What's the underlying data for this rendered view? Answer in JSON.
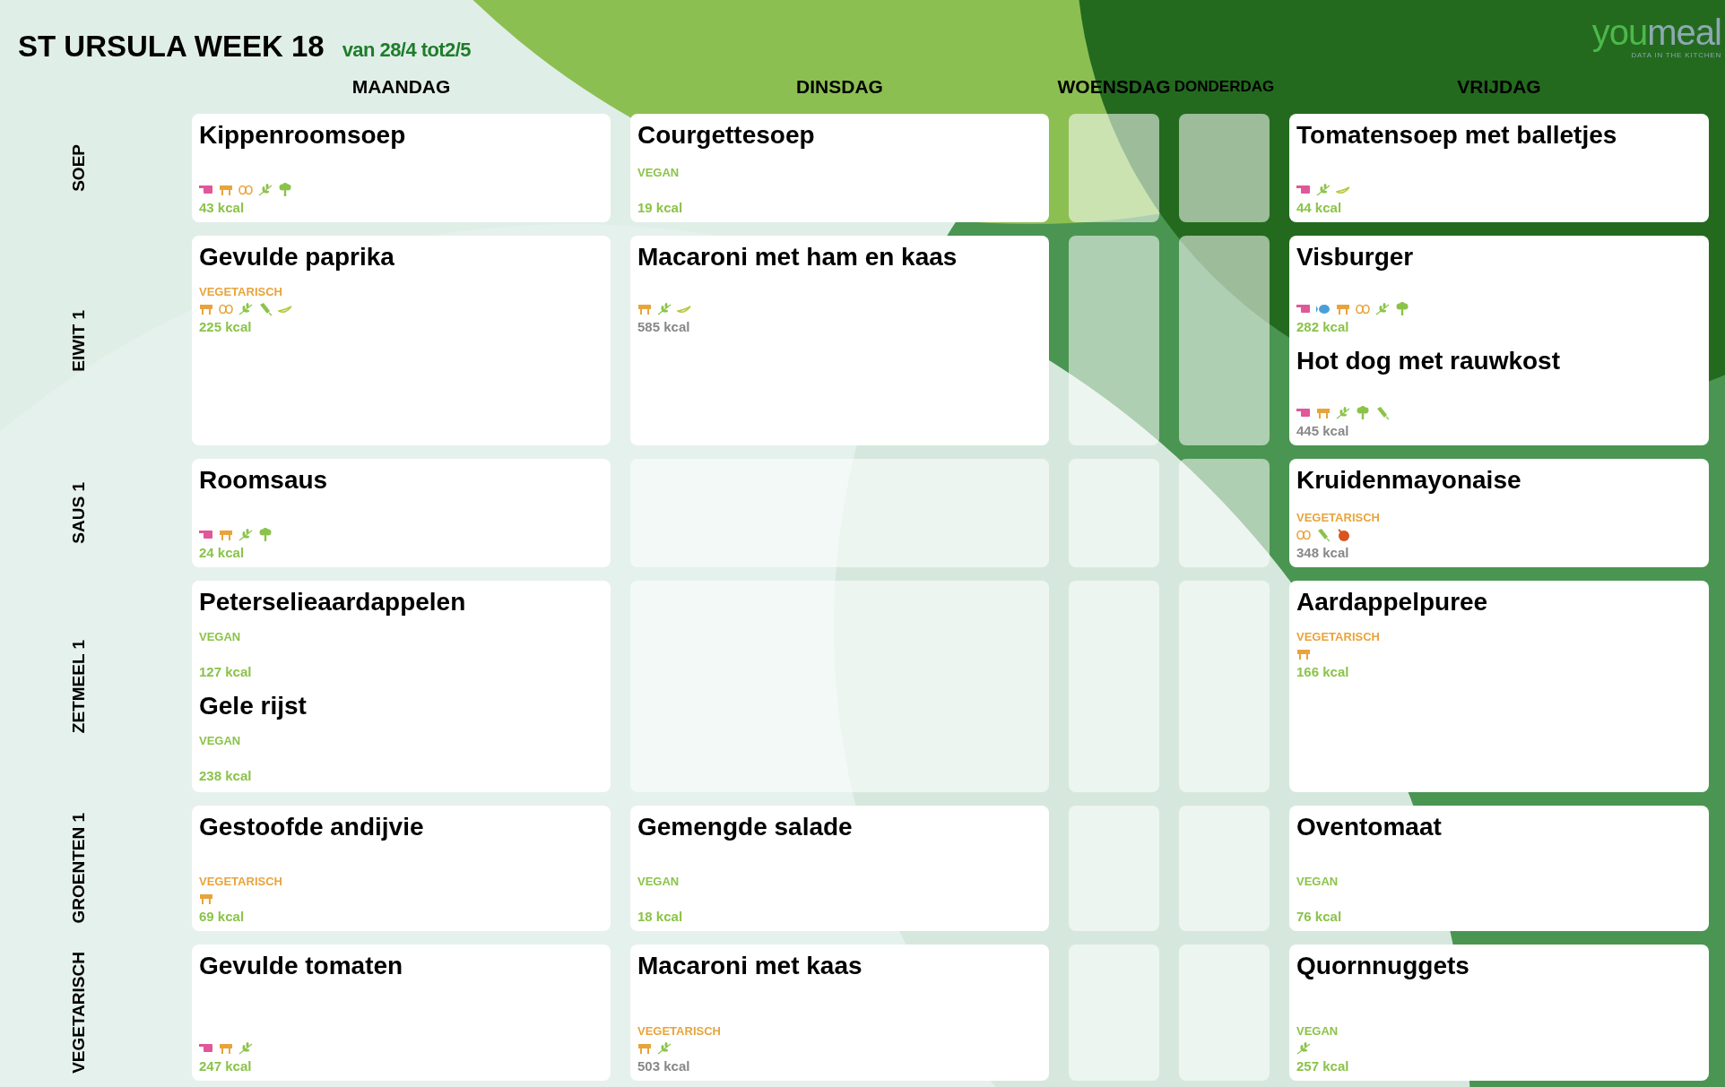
{
  "header": {
    "title": "ST URSULA WEEK 18",
    "date_range": "van 28/4 tot2/5"
  },
  "logo": {
    "wordmark": [
      "you",
      "meal"
    ],
    "tagline": "DATA IN THE KITCHEN"
  },
  "days": [
    "MAANDAG",
    "DINSDAG",
    "WOENSDAG",
    "DONDERDAG",
    "VRIJDAG"
  ],
  "rows": [
    {
      "label": "SOEP",
      "cells": [
        {
          "kind": "filled",
          "dishes": [
            {
              "name": "Kippenroomsoep",
              "allergens": [
                {
                  "kind": "meat"
                },
                {
                  "kind": "dairy"
                },
                {
                  "kind": "egg"
                },
                {
                  "kind": "gluten"
                },
                {
                  "kind": "celery"
                }
              ],
              "kcal": {
                "text": "43 kcal",
                "color": "#8bc34a"
              }
            }
          ]
        },
        {
          "kind": "filled",
          "dishes": [
            {
              "name": "Courgettesoep",
              "tag": {
                "label": "VEGAN",
                "color": "#8bc34a"
              },
              "kcal": {
                "text": "19 kcal",
                "color": "#8bc34a"
              }
            }
          ]
        },
        {
          "kind": "empty"
        },
        {
          "kind": "empty"
        },
        {
          "kind": "filled",
          "dishes": [
            {
              "name": "Tomatensoep met balletjes",
              "allergens": [
                {
                  "kind": "meat"
                },
                {
                  "kind": "gluten"
                },
                {
                  "kind": "pod"
                }
              ],
              "kcal": {
                "text": "44 kcal",
                "color": "#8bc34a"
              }
            }
          ]
        }
      ]
    },
    {
      "label": "EIWIT 1",
      "cells": [
        {
          "kind": "filled",
          "dishes": [
            {
              "name": "Gevulde paprika",
              "tag": {
                "label": "VEGETARISCH",
                "color": "#e8a43c"
              },
              "allergens": [
                {
                  "kind": "dairy"
                },
                {
                  "kind": "egg"
                },
                {
                  "kind": "gluten"
                },
                {
                  "kind": "mustard"
                },
                {
                  "kind": "pod"
                }
              ],
              "kcal": {
                "text": "225 kcal",
                "color": "#8bc34a"
              }
            }
          ]
        },
        {
          "kind": "filled",
          "dishes": [
            {
              "name": "Macaroni met ham en kaas",
              "allergens": [
                {
                  "kind": "dairy"
                },
                {
                  "kind": "gluten"
                },
                {
                  "kind": "pod"
                }
              ],
              "kcal": {
                "text": "585 kcal",
                "color": "#888888"
              }
            }
          ]
        },
        {
          "kind": "empty"
        },
        {
          "kind": "empty"
        },
        {
          "kind": "filled",
          "dishes": [
            {
              "name": "Visburger",
              "allergens": [
                {
                  "kind": "meat"
                },
                {
                  "kind": "fish"
                },
                {
                  "kind": "dairy"
                },
                {
                  "kind": "egg"
                },
                {
                  "kind": "gluten"
                },
                {
                  "kind": "celery"
                }
              ],
              "kcal": {
                "text": "282 kcal",
                "color": "#8bc34a"
              }
            },
            {
              "name": "Hot dog met rauwkost",
              "allergens": [
                {
                  "kind": "meat"
                },
                {
                  "kind": "dairy"
                },
                {
                  "kind": "gluten"
                },
                {
                  "kind": "celery"
                },
                {
                  "kind": "mustard"
                }
              ],
              "kcal": {
                "text": "445 kcal",
                "color": "#888888"
              }
            }
          ]
        }
      ]
    },
    {
      "label": "SAUS 1",
      "cells": [
        {
          "kind": "filled",
          "dishes": [
            {
              "name": "Roomsaus",
              "allergens": [
                {
                  "kind": "meat"
                },
                {
                  "kind": "dairy"
                },
                {
                  "kind": "gluten"
                },
                {
                  "kind": "celery"
                }
              ],
              "kcal": {
                "text": "24 kcal",
                "color": "#8bc34a"
              }
            }
          ]
        },
        {
          "kind": "empty"
        },
        {
          "kind": "empty"
        },
        {
          "kind": "empty"
        },
        {
          "kind": "filled",
          "dishes": [
            {
              "name": "Kruidenmayonaise",
              "tag": {
                "label": "VEGETARISCH",
                "color": "#e8a43c"
              },
              "allergens": [
                {
                  "kind": "egg"
                },
                {
                  "kind": "mustard"
                },
                {
                  "kind": "ball"
                }
              ],
              "kcal": {
                "text": "348 kcal",
                "color": "#888888"
              }
            }
          ]
        }
      ]
    },
    {
      "label": "ZETMEEL 1",
      "cells": [
        {
          "kind": "filled",
          "dishes": [
            {
              "name": "Peterselieaardappelen",
              "tag": {
                "label": "VEGAN",
                "color": "#8bc34a"
              },
              "kcal": {
                "text": "127 kcal",
                "color": "#8bc34a"
              }
            },
            {
              "name": "Gele rijst",
              "tag": {
                "label": "VEGAN",
                "color": "#8bc34a"
              },
              "kcal": {
                "text": "238 kcal",
                "color": "#8bc34a"
              }
            }
          ]
        },
        {
          "kind": "empty"
        },
        {
          "kind": "empty"
        },
        {
          "kind": "empty"
        },
        {
          "kind": "filled",
          "dishes": [
            {
              "name": "Aardappelpuree",
              "tag": {
                "label": "VEGETARISCH",
                "color": "#e8a43c"
              },
              "allergens": [
                {
                  "kind": "dairy"
                }
              ],
              "kcal": {
                "text": "166 kcal",
                "color": "#8bc34a"
              }
            }
          ]
        }
      ]
    },
    {
      "label": "GROENTEN 1",
      "cells": [
        {
          "kind": "filled",
          "dishes": [
            {
              "name": "Gestoofde andijvie",
              "tag": {
                "label": "VEGETARISCH",
                "color": "#e8a43c"
              },
              "allergens": [
                {
                  "kind": "dairy"
                }
              ],
              "kcal": {
                "text": "69 kcal",
                "color": "#8bc34a"
              }
            }
          ]
        },
        {
          "kind": "filled",
          "dishes": [
            {
              "name": "Gemengde salade",
              "tag": {
                "label": "VEGAN",
                "color": "#8bc34a"
              },
              "kcal": {
                "text": "18 kcal",
                "color": "#8bc34a"
              }
            }
          ]
        },
        {
          "kind": "empty"
        },
        {
          "kind": "empty"
        },
        {
          "kind": "filled",
          "dishes": [
            {
              "name": "Oventomaat",
              "tag": {
                "label": "VEGAN",
                "color": "#8bc34a"
              },
              "kcal": {
                "text": "76 kcal",
                "color": "#8bc34a"
              }
            }
          ]
        }
      ]
    },
    {
      "label": "VEGETARISCH",
      "cells": [
        {
          "kind": "filled",
          "dishes": [
            {
              "name": "Gevulde tomaten",
              "allergens": [
                {
                  "kind": "meat"
                },
                {
                  "kind": "dairy"
                },
                {
                  "kind": "gluten"
                }
              ],
              "kcal": {
                "text": "247 kcal",
                "color": "#8bc34a"
              }
            }
          ]
        },
        {
          "kind": "filled",
          "dishes": [
            {
              "name": "Macaroni met kaas",
              "tag": {
                "label": "VEGETARISCH",
                "color": "#e8a43c"
              },
              "allergens": [
                {
                  "kind": "dairy"
                },
                {
                  "kind": "gluten"
                }
              ],
              "kcal": {
                "text": "503 kcal",
                "color": "#888888"
              }
            }
          ]
        },
        {
          "kind": "empty"
        },
        {
          "kind": "empty"
        },
        {
          "kind": "filled",
          "dishes": [
            {
              "name": "Quornnuggets",
              "tag": {
                "label": "VEGAN",
                "color": "#8bc34a"
              },
              "allergens": [
                {
                  "kind": "gluten"
                }
              ],
              "kcal": {
                "text": "257 kcal",
                "color": "#8bc34a"
              }
            }
          ]
        }
      ]
    }
  ]
}
